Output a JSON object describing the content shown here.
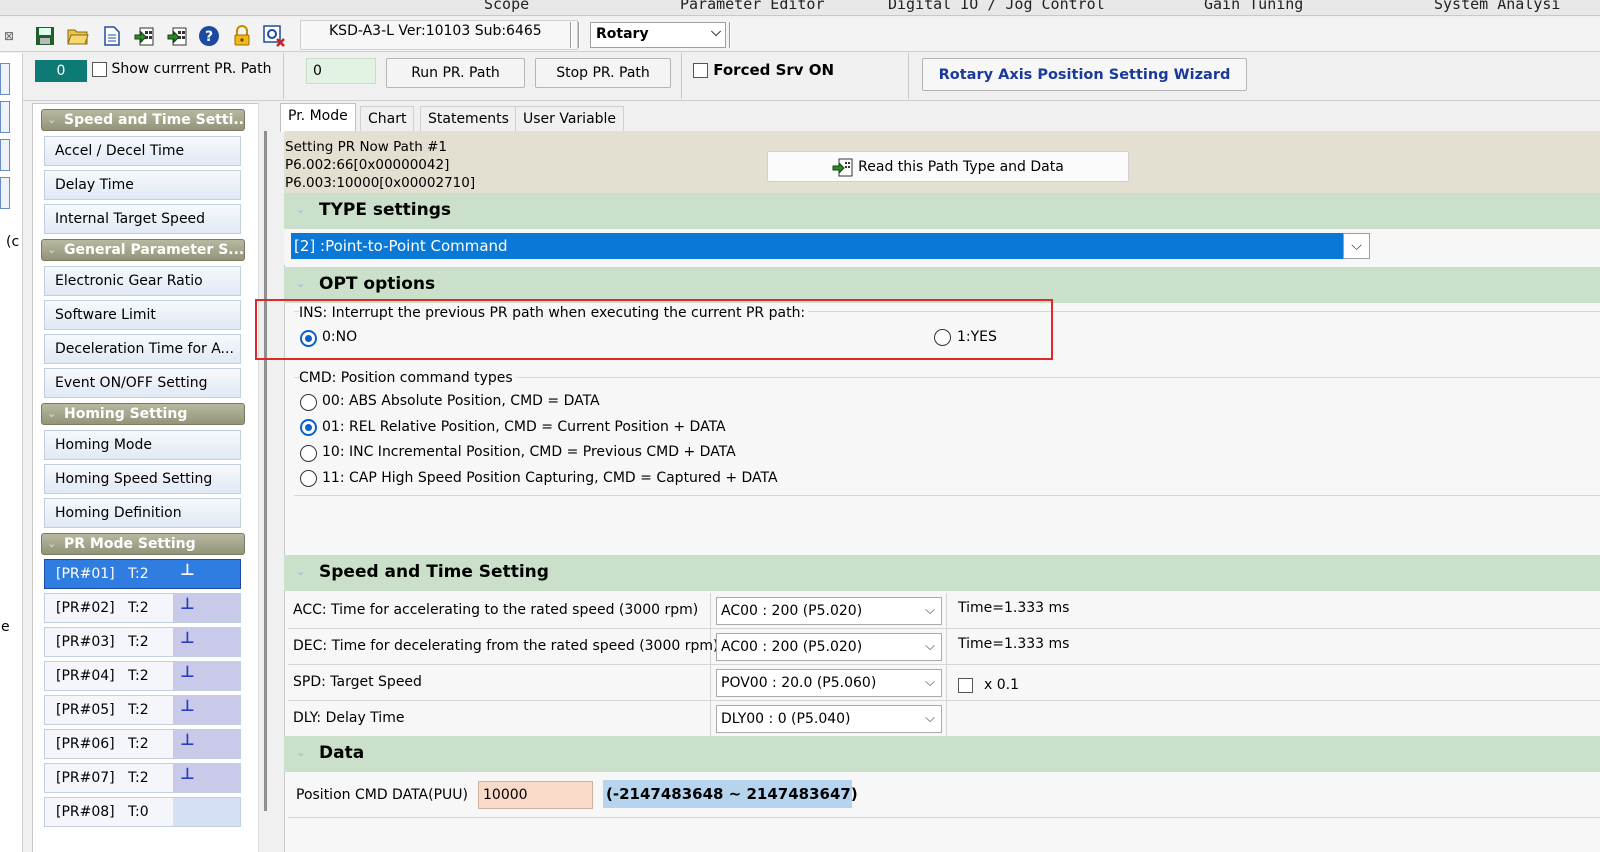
{
  "menu": {
    "items": [
      "Scope",
      "Parameter Editor",
      "Digital IO / Jog Control",
      "Gain Tuning",
      "System Analysi"
    ]
  },
  "toolbar": {
    "icons": [
      "save-icon",
      "open-folder-icon",
      "document-icon",
      "download-icon",
      "upload-icon",
      "help-icon",
      "lock-icon",
      "config-icon"
    ],
    "version_text": "KSD-A3-L Ver:10103 Sub:6465",
    "axis_mode": "Rotary"
  },
  "row2": {
    "counter_value": "0",
    "show_current_label": "Show currrent PR. Path",
    "path_input_value": "0",
    "run_label": "Run PR. Path",
    "stop_label": "Stop PR. Path",
    "forced_srv_label": "Forced Srv ON",
    "wizard_label": "Rotary Axis Position Setting Wizard"
  },
  "left_cut_text": [
    "(c",
    "e"
  ],
  "tree": {
    "groups": {
      "speed_time": "Speed and Time Setti...",
      "general": "General Parameter S...",
      "homing": "Homing Setting",
      "pr_mode": "PR Mode Setting"
    },
    "speed_items": [
      "Accel / Decel Time",
      "Delay Time",
      "Internal Target Speed"
    ],
    "general_items": [
      "Electronic Gear Ratio",
      "Software Limit",
      "Deceleration Time for A...",
      "Event ON/OFF Setting"
    ],
    "homing_items": [
      "Homing Mode",
      "Homing Speed Setting",
      "Homing Definition"
    ],
    "pr_items": [
      {
        "label": "[PR#01]",
        "type": "T:2"
      },
      {
        "label": "[PR#02]",
        "type": "T:2"
      },
      {
        "label": "[PR#03]",
        "type": "T:2"
      },
      {
        "label": "[PR#04]",
        "type": "T:2"
      },
      {
        "label": "[PR#05]",
        "type": "T:2"
      },
      {
        "label": "[PR#06]",
        "type": "T:2"
      },
      {
        "label": "[PR#07]",
        "type": "T:2"
      },
      {
        "label": "[PR#08]",
        "type": "T:0"
      }
    ]
  },
  "tabs": [
    "Pr. Mode",
    "Chart",
    "Statements",
    "User Variable"
  ],
  "info": {
    "line1": "Setting PR Now Path #1",
    "line2": "P6.002:66[0x00000042]",
    "line3": "P6.003:10000[0x00002710]",
    "read_button": "Read this Path Type and Data"
  },
  "type_section": {
    "title": "TYPE settings",
    "selected": "[2] :Point-to-Point Command"
  },
  "opt_section": {
    "title": "OPT options",
    "ins_label": "INS: Interrupt the previous PR path when executing the current PR path:",
    "ins_no": "0:NO",
    "ins_yes": "1:YES",
    "cmd_label": "CMD: Position command types",
    "cmd_options": [
      "00: ABS Absolute Position, CMD = DATA",
      "01: REL Relative Position, CMD = Current Position + DATA",
      "10: INC Incremental Position, CMD = Previous CMD + DATA",
      "11: CAP High Speed Position Capturing, CMD = Captured + DATA"
    ]
  },
  "speed_section": {
    "title": "Speed and Time Setting",
    "rows": [
      {
        "label": "ACC: Time for accelerating to the rated speed (3000 rpm)",
        "value": "AC00 : 200 (P5.020)",
        "extra": "Time=1.333 ms"
      },
      {
        "label": "DEC: Time for decelerating from the rated speed (3000 rpm)",
        "value": "AC00 : 200 (P5.020)",
        "extra": "Time=1.333 ms"
      },
      {
        "label": "SPD: Target Speed",
        "value": "POV00 : 20.0 (P5.060)",
        "extra": "x 0.1"
      },
      {
        "label": "DLY: Delay Time",
        "value": "DLY00 : 0 (P5.040)",
        "extra": ""
      }
    ]
  },
  "data_section": {
    "title": "Data",
    "pos_label": "Position CMD DATA(PUU)",
    "pos_value": "10000",
    "range": "(-2147483648 ~ 2147483647)"
  }
}
